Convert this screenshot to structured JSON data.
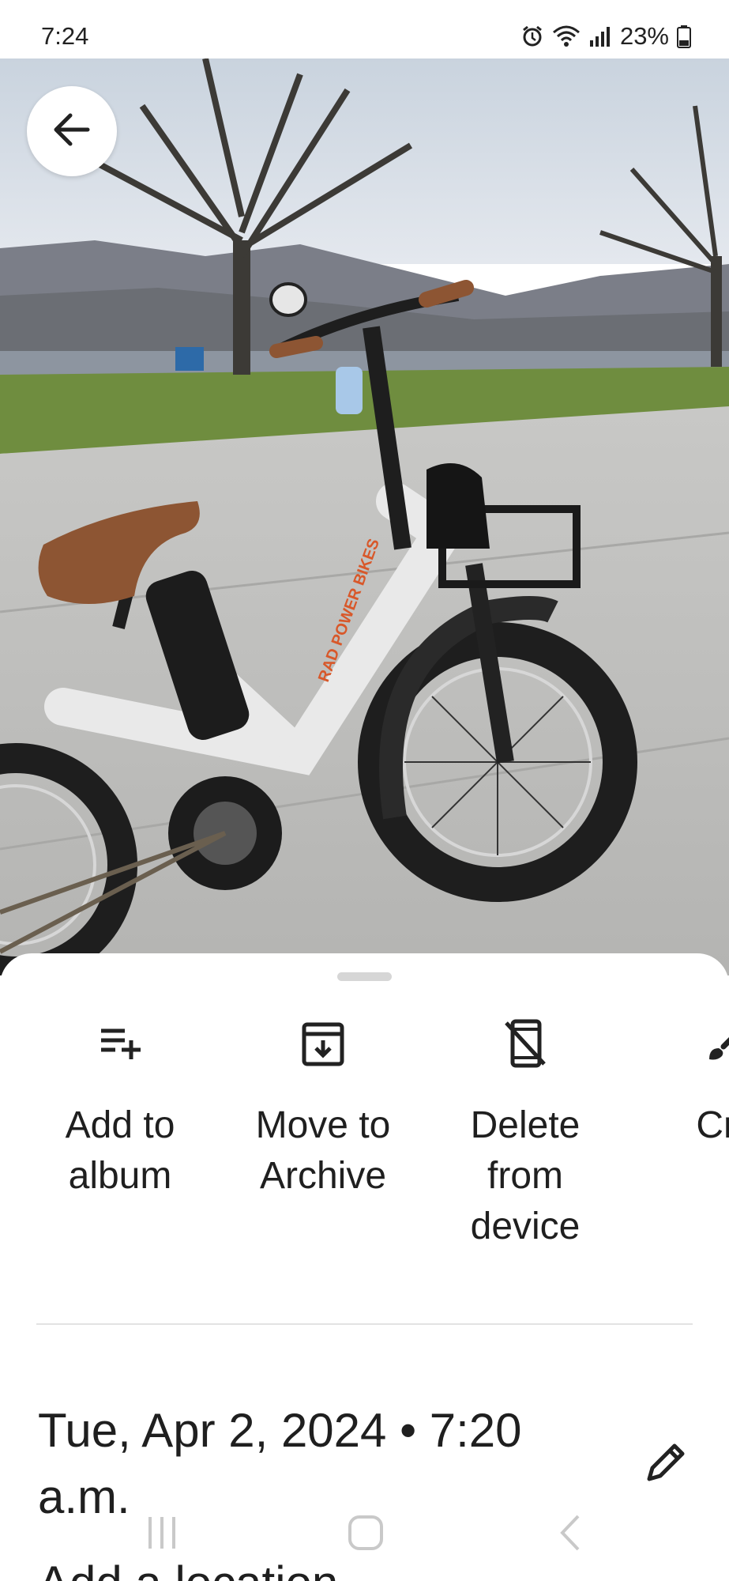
{
  "status_bar": {
    "time": "7:24",
    "battery": "23%",
    "icons": [
      "alarm-icon",
      "wifi-icon",
      "signal-icon",
      "battery-icon"
    ]
  },
  "photo": {
    "description_icon": "bike-photo"
  },
  "actions": [
    {
      "label": "Add to album",
      "icon": "playlist-add-icon"
    },
    {
      "label": "Move to Archive",
      "icon": "archive-icon"
    },
    {
      "label": "Delete from device",
      "icon": "phone-delete-icon"
    },
    {
      "label": "Cre",
      "icon": "brush-icon"
    }
  ],
  "details": {
    "date_time": "Tue, Apr 2, 2024 • 7:20 a.m.",
    "add_location": "Add a location"
  },
  "colors": {
    "sheet_bg": "#ffffff",
    "text": "#1f1f1f",
    "divider": "#e3e3e3"
  }
}
